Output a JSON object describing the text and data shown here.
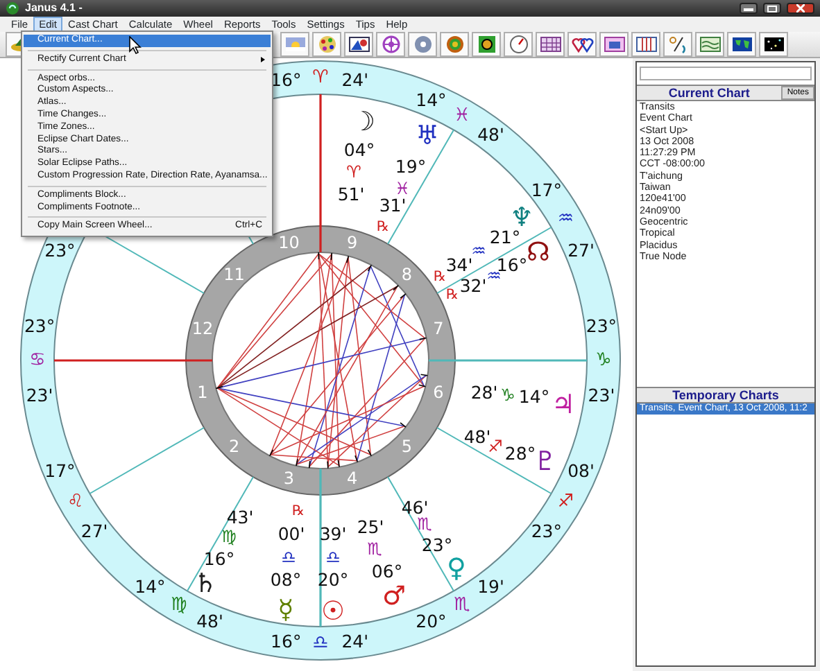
{
  "window": {
    "title": "Janus 4.1 -"
  },
  "menu_bar": [
    {
      "label": "File",
      "selected": false
    },
    {
      "label": "Edit",
      "selected": true
    },
    {
      "label": "Cast Chart",
      "selected": false
    },
    {
      "label": "Calculate",
      "selected": false
    },
    {
      "label": "Wheel",
      "selected": false
    },
    {
      "label": "Reports",
      "selected": false
    },
    {
      "label": "Tools",
      "selected": false
    },
    {
      "label": "Settings",
      "selected": false
    },
    {
      "label": "Tips",
      "selected": false
    },
    {
      "label": "Help",
      "selected": false
    }
  ],
  "edit_menu": [
    {
      "kind": "item",
      "label": "Current Chart...",
      "selected": true
    },
    {
      "kind": "separator"
    },
    {
      "kind": "submenu",
      "label": "Rectify Current Chart",
      "selected": false
    },
    {
      "kind": "separator"
    },
    {
      "kind": "item",
      "label": "Aspect orbs...",
      "selected": false
    },
    {
      "kind": "item",
      "label": "Custom Aspects...",
      "selected": false
    },
    {
      "kind": "item",
      "label": "Atlas...",
      "selected": false
    },
    {
      "kind": "item",
      "label": "Time Changes...",
      "selected": false
    },
    {
      "kind": "item",
      "label": "Time Zones...",
      "selected": false
    },
    {
      "kind": "item",
      "label": "Eclipse Chart Dates...",
      "selected": false
    },
    {
      "kind": "item",
      "label": "Stars...",
      "selected": false
    },
    {
      "kind": "item",
      "label": "Solar Eclipse Paths...",
      "selected": false
    },
    {
      "kind": "item",
      "label": "Custom Progression Rate, Direction Rate, Ayanamsa...",
      "selected": false
    },
    {
      "kind": "separator"
    },
    {
      "kind": "item",
      "label": "Compliments Block...",
      "selected": false
    },
    {
      "kind": "item",
      "label": "Compliments Footnote...",
      "selected": false
    },
    {
      "kind": "separator"
    },
    {
      "kind": "item",
      "label": "Copy Main Screen Wheel...",
      "shortcut": "Ctrl+C",
      "selected": false
    }
  ],
  "chart": {
    "house_numbers": [
      "1",
      "2",
      "3",
      "4",
      "5",
      "6",
      "7",
      "8",
      "9",
      "10",
      "11",
      "12"
    ],
    "cusps": [
      {
        "degree": "16°",
        "sign": {
          "text": "♈",
          "color": "#d02020"
        },
        "minute": "24'"
      },
      {
        "degree": "14°",
        "sign": {
          "text": "♓",
          "color": "#a020a0"
        },
        "minute": "48'"
      },
      {
        "degree": "17°",
        "sign": {
          "text": "♒",
          "color": "#2030c0"
        },
        "minute": "27'"
      },
      {
        "degree": "23°",
        "sign": {
          "text": "♑",
          "color": "#208020"
        },
        "minute": "23'"
      },
      {
        "degree": "23°",
        "sign": {
          "text": "♐",
          "color": "#d02020"
        },
        "minute": "08'"
      },
      {
        "degree": "20°",
        "sign": {
          "text": "♏",
          "color": "#a020a0"
        },
        "minute": "19'"
      },
      {
        "degree": "16°",
        "sign": {
          "text": "♎",
          "color": "#2030c0"
        },
        "minute": "24'"
      },
      {
        "degree": "14°",
        "sign": {
          "text": "♍",
          "color": "#208020"
        },
        "minute": "48'"
      },
      {
        "degree": "17°",
        "sign": {
          "text": "♌",
          "color": "#d02020"
        },
        "minute": "27'"
      },
      {
        "degree": "23°",
        "sign": {
          "text": "♋",
          "color": "#a020a0"
        },
        "minute": "23'"
      },
      {
        "degree": "23°"
      }
    ],
    "planets": [
      {
        "glyph": {
          "text": "☽",
          "color": "#202020"
        },
        "degree": "04°",
        "sign": {
          "text": "♈",
          "color": "#d02020"
        },
        "minute": "51'"
      },
      {
        "glyph": {
          "text": "♅",
          "color": "#2030c0"
        },
        "degree": "19°",
        "sign": {
          "text": "♓",
          "color": "#a020a0"
        },
        "minute": "31'",
        "retrograde_mark": "℞"
      },
      {
        "glyph": {
          "text": "♆",
          "color": "#108080"
        },
        "degree": "21°",
        "sign": {
          "text": "♒",
          "color": "#2030c0"
        },
        "minute": "34'",
        "retrograde_mark": "℞"
      },
      {
        "glyph": {
          "text": "☊",
          "color": "#901010"
        },
        "degree": "16°",
        "sign": {
          "text": "♒",
          "color": "#2030c0"
        },
        "minute": "32'",
        "retrograde_mark": "℞"
      },
      {
        "glyph": {
          "text": "♃",
          "color": "#c020a0"
        },
        "degree": "14°",
        "sign": {
          "text": "♑",
          "color": "#208020"
        },
        "minute": "28'"
      },
      {
        "glyph": {
          "text": "♇",
          "color": "#8020a0"
        },
        "degree": "28°",
        "sign": {
          "text": "♐",
          "color": "#d02020"
        },
        "minute": "48'"
      },
      {
        "glyph": {
          "text": "♄",
          "color": "#202020"
        },
        "degree": "16°",
        "sign": {
          "text": "♍",
          "color": "#208020"
        },
        "minute": "43'"
      },
      {
        "glyph": {
          "text": "☿",
          "color": "#608000"
        },
        "degree": "08°",
        "sign": {
          "text": "♎",
          "color": "#2030c0"
        },
        "minute": "00'",
        "retrograde_mark": "℞"
      },
      {
        "glyph": {
          "text": "☉",
          "color": "#d02020"
        },
        "degree": "20°",
        "sign": {
          "text": "♎",
          "color": "#2030c0"
        },
        "minute": "39'"
      },
      {
        "glyph": {
          "text": "♂",
          "color": "#d02020"
        },
        "degree": "06°",
        "sign": {
          "text": "♏",
          "color": "#a020a0"
        },
        "minute": "25'"
      },
      {
        "glyph": {
          "text": "♀",
          "color": "#10a0a0"
        },
        "degree": "23°",
        "sign": {
          "text": "♏",
          "color": "#a020a0"
        },
        "minute": "46'"
      }
    ]
  },
  "current_chart": {
    "title": "Current Chart",
    "notes_button": "Notes",
    "lines": [
      "Transits",
      "Event Chart",
      "<Start Up>",
      "13 Oct 2008",
      "11:27:29 PM",
      "CCT -08:00:00",
      "T'aichung",
      "Taiwan",
      "120e41'00",
      "24n09'00",
      "Geocentric",
      "Tropical",
      "Placidus",
      "True Node"
    ]
  },
  "temporary_charts": {
    "title": "Temporary Charts",
    "items": [
      {
        "label": "Transits,  Event Chart, 13 Oct 2008, 11:2",
        "selected": true
      }
    ]
  }
}
